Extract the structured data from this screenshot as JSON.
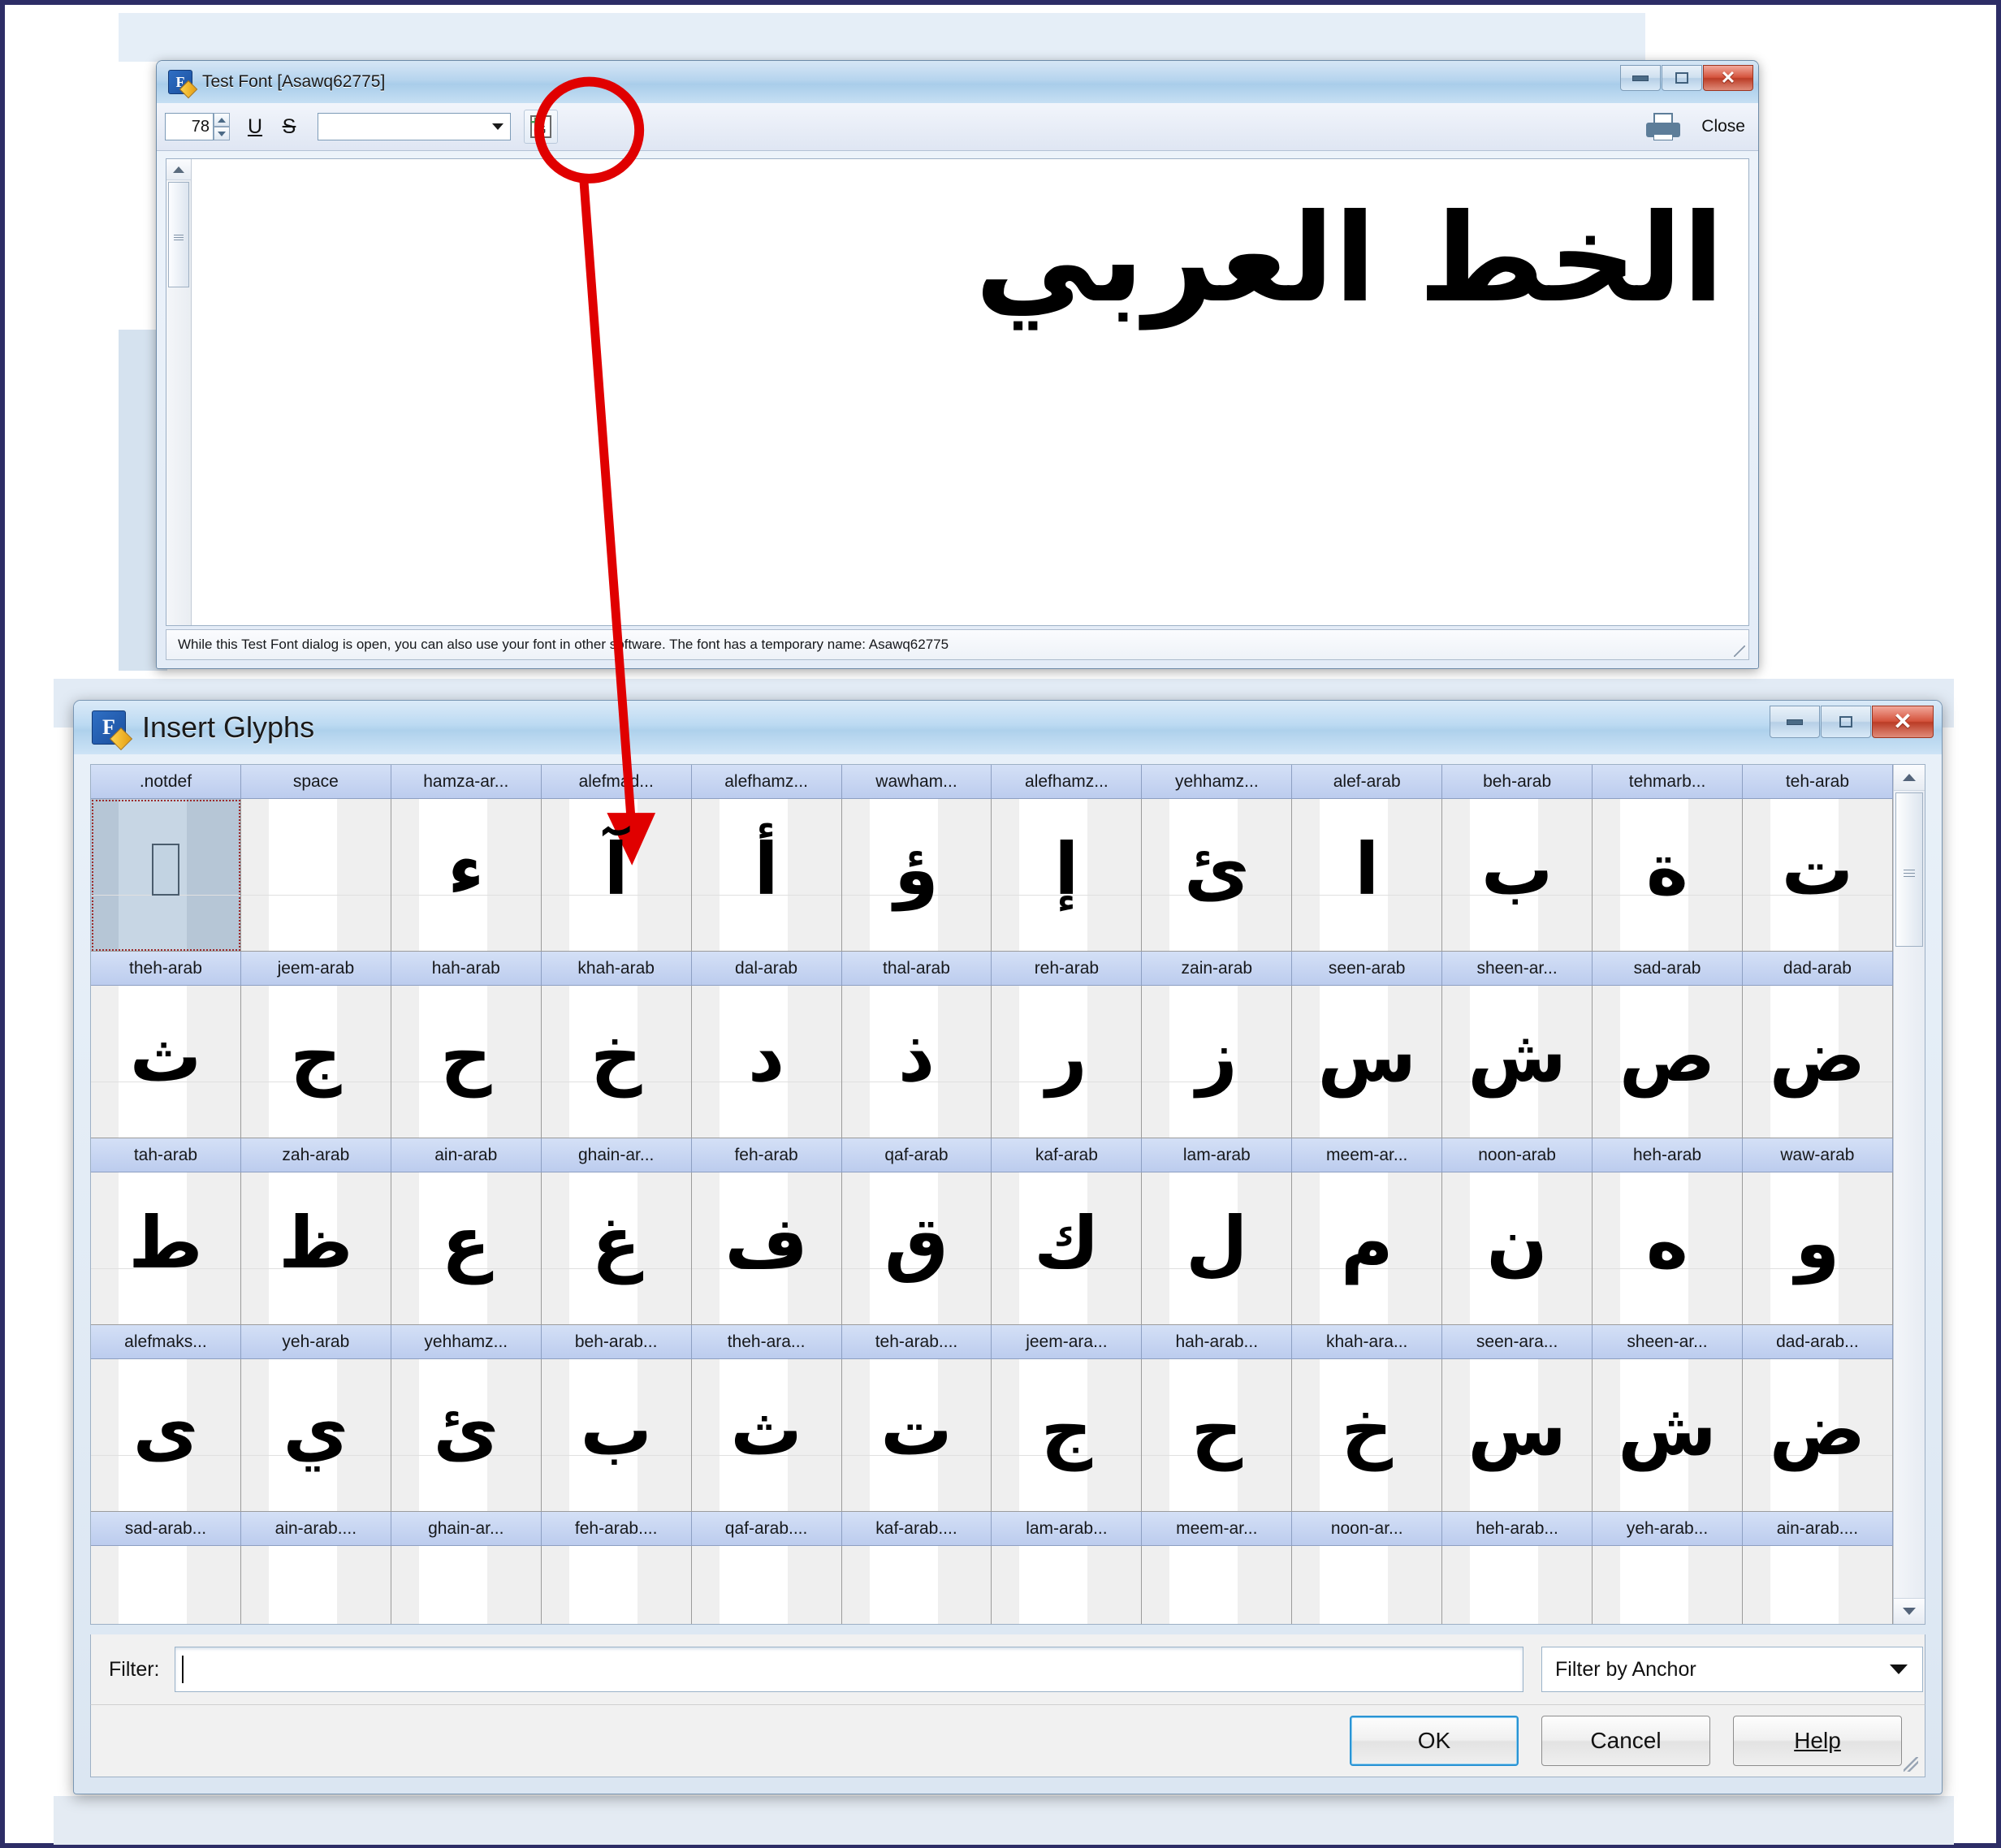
{
  "test_font_window": {
    "title": "Test Font [Asawq62775]",
    "icon": "fontcreator-icon",
    "window_controls": {
      "minimize": "minimize-icon",
      "maximize": "maximize-icon",
      "close": "close-icon"
    },
    "toolbar": {
      "font_size": "78",
      "underline_label": "U",
      "strikethrough_label": "S",
      "sample_text_value": "",
      "insert_glyphs_button": "G",
      "print_icon": "printer-icon",
      "close_label": "Close"
    },
    "preview_text": "الخط العربي",
    "status_text": "While this Test Font dialog is open, you can also use your font in other software. The font has a temporary name: Asawq62775"
  },
  "insert_glyphs_window": {
    "title": "Insert Glyphs",
    "icon": "fontcreator-icon",
    "window_controls": {
      "minimize": "minimize-icon",
      "maximize": "maximize-icon",
      "close": "close-icon"
    },
    "filter": {
      "label": "Filter:",
      "value": "",
      "placeholder": ""
    },
    "anchor_filter": {
      "selected": "Filter by Anchor"
    },
    "buttons": {
      "ok": "OK",
      "cancel": "Cancel",
      "help": "Help"
    },
    "grid": {
      "columns": 12,
      "rows": [
        {
          "cells": [
            {
              "label": ".notdef",
              "glyph": "",
              "selected": true,
              "notdef": true
            },
            {
              "label": "space",
              "glyph": "",
              "selected": false,
              "notdef": false
            },
            {
              "label": "hamza-ar...",
              "glyph": "ء",
              "selected": false,
              "notdef": false
            },
            {
              "label": "alefmad...",
              "glyph": "آ",
              "selected": false,
              "notdef": false
            },
            {
              "label": "alefhamz...",
              "glyph": "أ",
              "selected": false,
              "notdef": false
            },
            {
              "label": "wawham...",
              "glyph": "ؤ",
              "selected": false,
              "notdef": false
            },
            {
              "label": "alefhamz...",
              "glyph": "إ",
              "selected": false,
              "notdef": false
            },
            {
              "label": "yehhamz...",
              "glyph": "ئ",
              "selected": false,
              "notdef": false
            },
            {
              "label": "alef-arab",
              "glyph": "ا",
              "selected": false,
              "notdef": false
            },
            {
              "label": "beh-arab",
              "glyph": "ب",
              "selected": false,
              "notdef": false
            },
            {
              "label": "tehmarb...",
              "glyph": "ة",
              "selected": false,
              "notdef": false
            },
            {
              "label": "teh-arab",
              "glyph": "ت",
              "selected": false,
              "notdef": false
            }
          ]
        },
        {
          "cells": [
            {
              "label": "theh-arab",
              "glyph": "ث",
              "selected": false,
              "notdef": false
            },
            {
              "label": "jeem-arab",
              "glyph": "ج",
              "selected": false,
              "notdef": false
            },
            {
              "label": "hah-arab",
              "glyph": "ح",
              "selected": false,
              "notdef": false
            },
            {
              "label": "khah-arab",
              "glyph": "خ",
              "selected": false,
              "notdef": false
            },
            {
              "label": "dal-arab",
              "glyph": "د",
              "selected": false,
              "notdef": false
            },
            {
              "label": "thal-arab",
              "glyph": "ذ",
              "selected": false,
              "notdef": false
            },
            {
              "label": "reh-arab",
              "glyph": "ر",
              "selected": false,
              "notdef": false
            },
            {
              "label": "zain-arab",
              "glyph": "ز",
              "selected": false,
              "notdef": false
            },
            {
              "label": "seen-arab",
              "glyph": "س",
              "selected": false,
              "notdef": false
            },
            {
              "label": "sheen-ar...",
              "glyph": "ش",
              "selected": false,
              "notdef": false
            },
            {
              "label": "sad-arab",
              "glyph": "ص",
              "selected": false,
              "notdef": false
            },
            {
              "label": "dad-arab",
              "glyph": "ض",
              "selected": false,
              "notdef": false
            }
          ]
        },
        {
          "cells": [
            {
              "label": "tah-arab",
              "glyph": "ط",
              "selected": false,
              "notdef": false
            },
            {
              "label": "zah-arab",
              "glyph": "ظ",
              "selected": false,
              "notdef": false
            },
            {
              "label": "ain-arab",
              "glyph": "ع",
              "selected": false,
              "notdef": false
            },
            {
              "label": "ghain-ar...",
              "glyph": "غ",
              "selected": false,
              "notdef": false
            },
            {
              "label": "feh-arab",
              "glyph": "ف",
              "selected": false,
              "notdef": false
            },
            {
              "label": "qaf-arab",
              "glyph": "ق",
              "selected": false,
              "notdef": false
            },
            {
              "label": "kaf-arab",
              "glyph": "ك",
              "selected": false,
              "notdef": false
            },
            {
              "label": "lam-arab",
              "glyph": "ل",
              "selected": false,
              "notdef": false
            },
            {
              "label": "meem-ar...",
              "glyph": "م",
              "selected": false,
              "notdef": false
            },
            {
              "label": "noon-arab",
              "glyph": "ن",
              "selected": false,
              "notdef": false
            },
            {
              "label": "heh-arab",
              "glyph": "ه",
              "selected": false,
              "notdef": false
            },
            {
              "label": "waw-arab",
              "glyph": "و",
              "selected": false,
              "notdef": false
            }
          ]
        },
        {
          "cells": [
            {
              "label": "alefmaks...",
              "glyph": "ى",
              "selected": false,
              "notdef": false
            },
            {
              "label": "yeh-arab",
              "glyph": "ي",
              "selected": false,
              "notdef": false
            },
            {
              "label": "yehhamz...",
              "glyph": "ئ",
              "selected": false,
              "notdef": false
            },
            {
              "label": "beh-arab...",
              "glyph": "ب",
              "selected": false,
              "notdef": false
            },
            {
              "label": "theh-ara...",
              "glyph": "ث",
              "selected": false,
              "notdef": false
            },
            {
              "label": "teh-arab....",
              "glyph": "ت",
              "selected": false,
              "notdef": false
            },
            {
              "label": "jeem-ara...",
              "glyph": "ج",
              "selected": false,
              "notdef": false
            },
            {
              "label": "hah-arab...",
              "glyph": "ح",
              "selected": false,
              "notdef": false
            },
            {
              "label": "khah-ara...",
              "glyph": "خ",
              "selected": false,
              "notdef": false
            },
            {
              "label": "seen-ara...",
              "glyph": "س",
              "selected": false,
              "notdef": false
            },
            {
              "label": "sheen-ar...",
              "glyph": "ش",
              "selected": false,
              "notdef": false
            },
            {
              "label": "dad-arab...",
              "glyph": "ض",
              "selected": false,
              "notdef": false
            }
          ]
        },
        {
          "cells": [
            {
              "label": "sad-arab...",
              "glyph": "",
              "selected": false,
              "notdef": false
            },
            {
              "label": "ain-arab....",
              "glyph": "",
              "selected": false,
              "notdef": false
            },
            {
              "label": "ghain-ar...",
              "glyph": "",
              "selected": false,
              "notdef": false
            },
            {
              "label": "feh-arab....",
              "glyph": "",
              "selected": false,
              "notdef": false
            },
            {
              "label": "qaf-arab....",
              "glyph": "",
              "selected": false,
              "notdef": false
            },
            {
              "label": "kaf-arab....",
              "glyph": "",
              "selected": false,
              "notdef": false
            },
            {
              "label": "lam-arab...",
              "glyph": "",
              "selected": false,
              "notdef": false
            },
            {
              "label": "meem-ar...",
              "glyph": "",
              "selected": false,
              "notdef": false
            },
            {
              "label": "noon-ar...",
              "glyph": "",
              "selected": false,
              "notdef": false
            },
            {
              "label": "heh-arab...",
              "glyph": "",
              "selected": false,
              "notdef": false
            },
            {
              "label": "yeh-arab...",
              "glyph": "",
              "selected": false,
              "notdef": false
            },
            {
              "label": "ain-arab....",
              "glyph": "",
              "selected": false,
              "notdef": false
            }
          ]
        }
      ]
    }
  },
  "annotation": {
    "highlight_shape": "red-ellipse",
    "arrow": "red-arrow",
    "color": "#e00000"
  }
}
